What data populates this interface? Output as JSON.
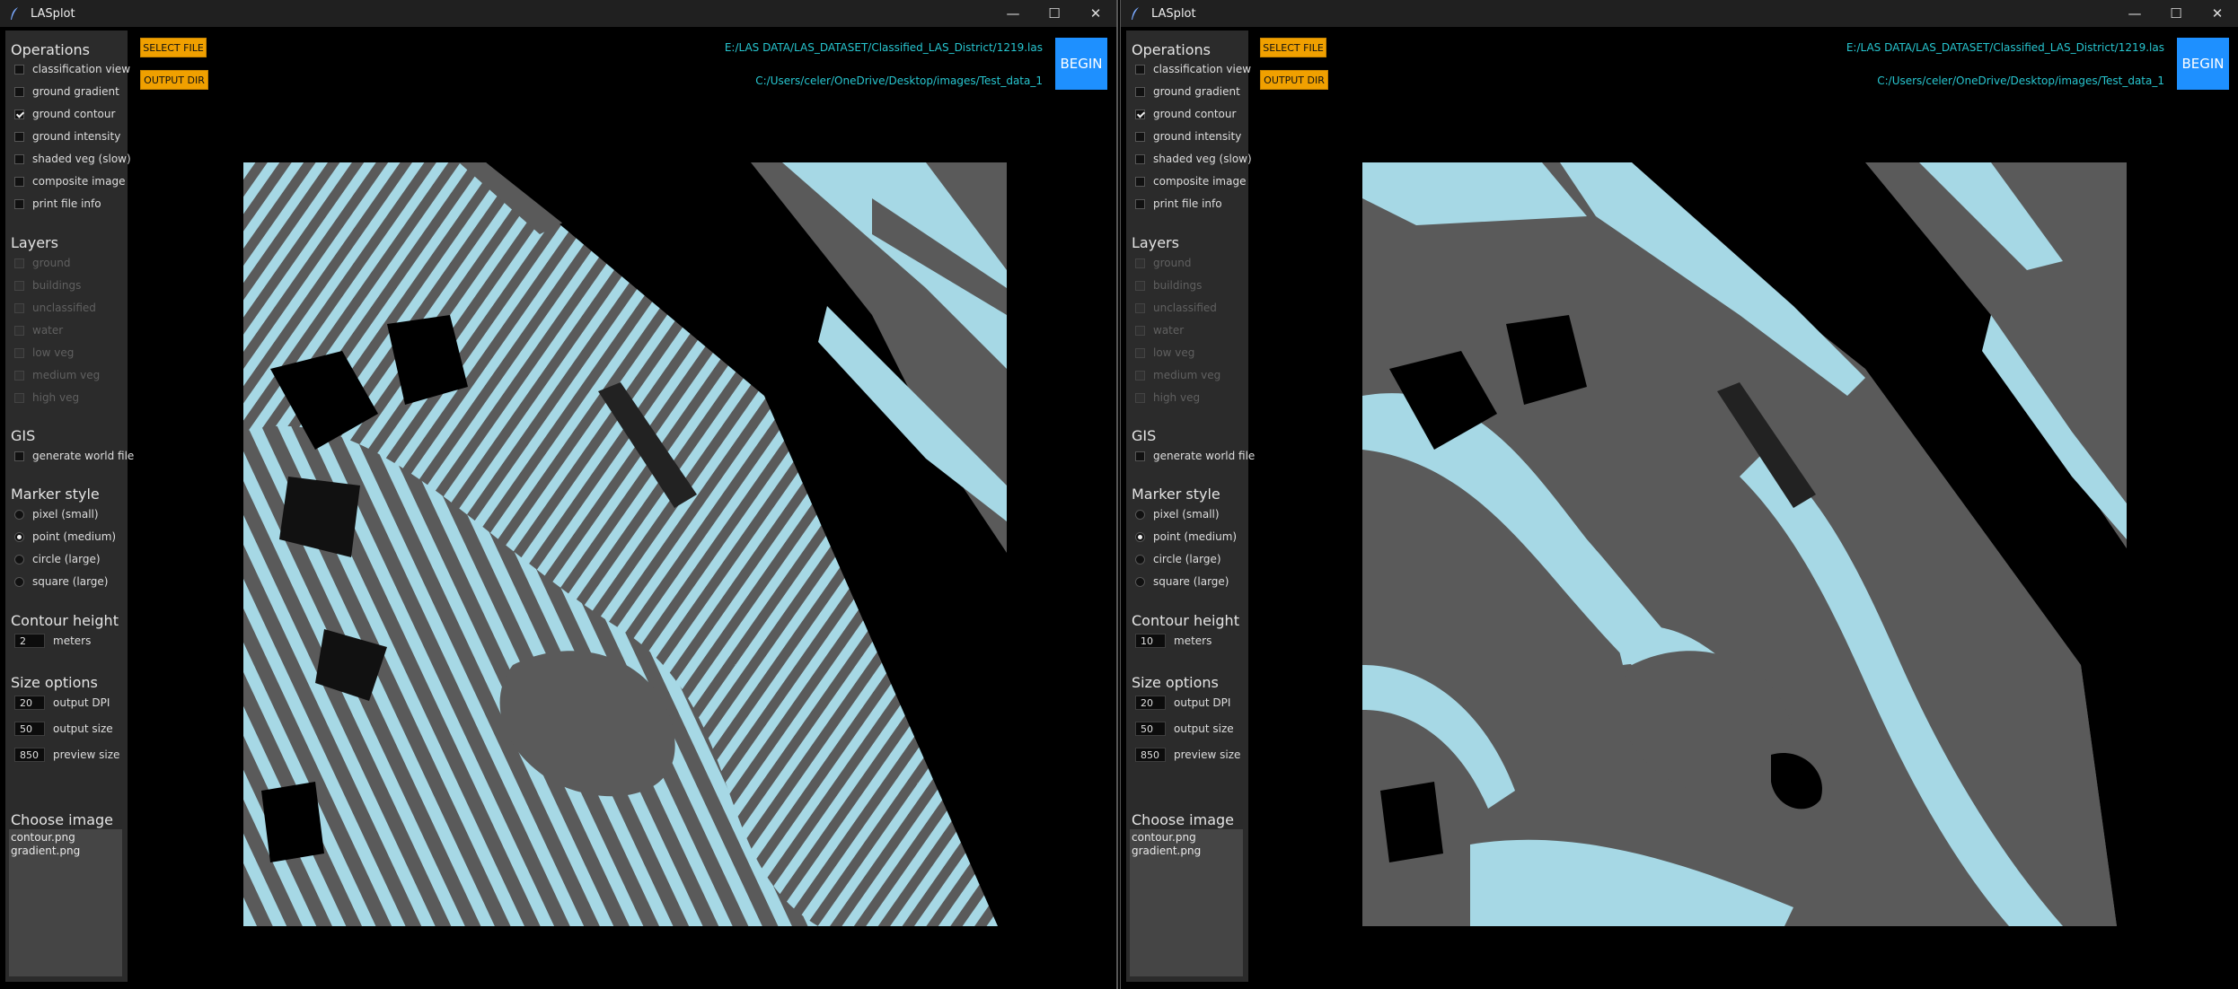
{
  "windows": [
    {
      "title": "LASplot",
      "controls": {
        "minimize": "—",
        "maximize": "☐",
        "close": "✕"
      },
      "sections": {
        "operations": "Operations",
        "layers": "Layers",
        "gis": "GIS",
        "marker_style": "Marker style",
        "contour_height": "Contour height",
        "size_options": "Size options",
        "choose_image": "Choose image"
      },
      "operations": [
        {
          "label": "classification view",
          "checked": false
        },
        {
          "label": "ground gradient",
          "checked": false
        },
        {
          "label": "ground contour",
          "checked": true
        },
        {
          "label": "ground intensity",
          "checked": false
        },
        {
          "label": "shaded veg (slow)",
          "checked": false
        },
        {
          "label": "composite image",
          "checked": false
        },
        {
          "label": "print file info",
          "checked": false
        }
      ],
      "layers": [
        {
          "label": "ground"
        },
        {
          "label": "buildings"
        },
        {
          "label": "unclassified"
        },
        {
          "label": "water"
        },
        {
          "label": "low veg"
        },
        {
          "label": "medium veg"
        },
        {
          "label": "high veg"
        }
      ],
      "gis": [
        {
          "label": "generate world file",
          "checked": false
        }
      ],
      "marker_styles": [
        {
          "label": "pixel (small)",
          "selected": false
        },
        {
          "label": "point (medium)",
          "selected": true
        },
        {
          "label": "circle (large)",
          "selected": false
        },
        {
          "label": "square (large)",
          "selected": false
        }
      ],
      "contour": {
        "value": "2",
        "unit": "meters"
      },
      "size_options": [
        {
          "value": "20",
          "label": "output DPI"
        },
        {
          "value": "50",
          "label": "output size"
        },
        {
          "value": "850",
          "label": "preview size"
        }
      ],
      "images": [
        "contour.png",
        "gradient.png"
      ],
      "select_file_label": "SELECT FILE",
      "output_dir_label": "OUTPUT DIR",
      "input_path": "E:/LAS DATA/LAS_DATASET/Classified_LAS_District/1219.las",
      "output_path": "C:/Users/celer/OneDrive/Desktop/images/Test_data_1",
      "begin_label": "BEGIN"
    },
    {
      "title": "LASplot",
      "controls": {
        "minimize": "—",
        "maximize": "☐",
        "close": "✕"
      },
      "sections": {
        "operations": "Operations",
        "layers": "Layers",
        "gis": "GIS",
        "marker_style": "Marker style",
        "contour_height": "Contour height",
        "size_options": "Size options",
        "choose_image": "Choose image"
      },
      "operations": [
        {
          "label": "classification view",
          "checked": false
        },
        {
          "label": "ground gradient",
          "checked": false
        },
        {
          "label": "ground contour",
          "checked": true
        },
        {
          "label": "ground intensity",
          "checked": false
        },
        {
          "label": "shaded veg (slow)",
          "checked": false
        },
        {
          "label": "composite image",
          "checked": false
        },
        {
          "label": "print file info",
          "checked": false
        }
      ],
      "layers": [
        {
          "label": "ground"
        },
        {
          "label": "buildings"
        },
        {
          "label": "unclassified"
        },
        {
          "label": "water"
        },
        {
          "label": "low veg"
        },
        {
          "label": "medium veg"
        },
        {
          "label": "high veg"
        }
      ],
      "gis": [
        {
          "label": "generate world file",
          "checked": false
        }
      ],
      "marker_styles": [
        {
          "label": "pixel (small)",
          "selected": false
        },
        {
          "label": "point (medium)",
          "selected": true
        },
        {
          "label": "circle (large)",
          "selected": false
        },
        {
          "label": "square (large)",
          "selected": false
        }
      ],
      "contour": {
        "value": "10",
        "unit": "meters"
      },
      "size_options": [
        {
          "value": "20",
          "label": "output DPI"
        },
        {
          "value": "50",
          "label": "output size"
        },
        {
          "value": "850",
          "label": "preview size"
        }
      ],
      "images": [
        "contour.png",
        "gradient.png"
      ],
      "select_file_label": "SELECT FILE",
      "output_dir_label": "OUTPUT DIR",
      "input_path": "E:/LAS DATA/LAS_DATASET/Classified_LAS_District/1219.las",
      "output_path": "C:/Users/celer/OneDrive/Desktop/images/Test_data_1",
      "begin_label": "BEGIN"
    }
  ],
  "colors": {
    "contour_light": "#a6d8e5",
    "contour_gray": "#5a5a5a",
    "accent_orange": "#f0a000",
    "begin_blue": "#1e90ff",
    "path_cyan": "#27c6d0"
  }
}
